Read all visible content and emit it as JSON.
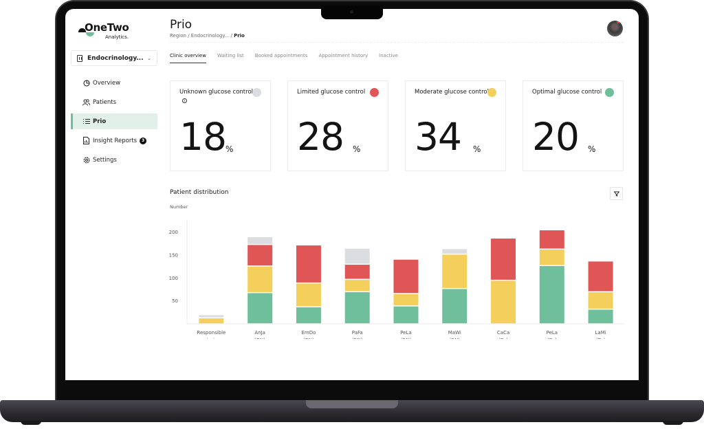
{
  "app": {
    "brand": "OneTwo",
    "brand_sub": "Analytics."
  },
  "sidebar": {
    "clinic_select": "Endocrinology...",
    "items": [
      {
        "label": "Overview",
        "icon": "pie-chart-icon"
      },
      {
        "label": "Patients",
        "icon": "users-icon"
      },
      {
        "label": "Prio",
        "icon": "list-icon",
        "active": true
      },
      {
        "label": "Insight Reports",
        "icon": "report-icon",
        "badge": "3"
      },
      {
        "label": "Settings",
        "icon": "gear-icon"
      }
    ]
  },
  "header": {
    "title": "Prio",
    "breadcrumb": [
      "Region",
      "Endocrinology...",
      "Prio"
    ]
  },
  "tabs": [
    {
      "label": "Clinic overview",
      "active": true
    },
    {
      "label": "Waiting list"
    },
    {
      "label": "Booked appointments"
    },
    {
      "label": "Appointment history"
    },
    {
      "label": "Inactive"
    }
  ],
  "cards": [
    {
      "title": "Unknown glucose control",
      "value": "18",
      "unit": "%",
      "color": "#dcdde0",
      "info": true
    },
    {
      "title": "Limited glucose control",
      "value": "28",
      "unit": "%",
      "color": "#e05555"
    },
    {
      "title": "Moderate glucose control",
      "value": "34",
      "unit": "%",
      "color": "#f5cf5b"
    },
    {
      "title": "Optimal glucose control",
      "value": "20",
      "unit": "%",
      "color": "#6fbf9c"
    }
  ],
  "distribution": {
    "title": "Patient distribution"
  },
  "chart_data": {
    "type": "bar",
    "stacked": true,
    "title": "Patient distribution",
    "ylabel": "Number",
    "xlabel": "",
    "ylim": [
      0,
      220
    ],
    "yticks": [
      50,
      100,
      150,
      200
    ],
    "grid": false,
    "categories": [
      [
        "Responsible",
        "missing"
      ],
      [
        "AnJa",
        "(RN)"
      ],
      [
        "EmDo",
        "(RN)"
      ],
      [
        "PaFa",
        "(RN)"
      ],
      [
        "PeLa",
        "(RN)"
      ],
      [
        "MaWi",
        "(RN)"
      ],
      [
        "CaCa",
        "(Dr)"
      ],
      [
        "PeLa",
        "(Dr)"
      ],
      [
        "LaMi",
        "(Dr)"
      ]
    ],
    "series": [
      {
        "name": "Optimal glucose control",
        "color": "#6fbf9c",
        "values": [
          0,
          68,
          37,
          70,
          39,
          77,
          0,
          127,
          32
        ]
      },
      {
        "name": "Moderate glucose control",
        "color": "#f5cf5b",
        "values": [
          13,
          58,
          52,
          27,
          27,
          75,
          95,
          36,
          38
        ]
      },
      {
        "name": "Limited glucose control",
        "color": "#e05555",
        "values": [
          0,
          47,
          83,
          33,
          75,
          0,
          92,
          42,
          67
        ]
      },
      {
        "name": "Unknown glucose control",
        "color": "#dcdde0",
        "values": [
          7,
          17,
          0,
          35,
          0,
          12,
          0,
          0,
          0
        ]
      }
    ]
  }
}
